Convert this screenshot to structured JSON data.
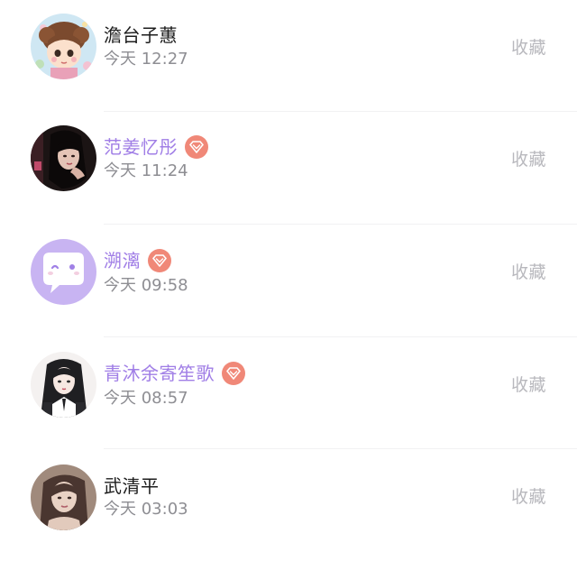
{
  "list": {
    "items": [
      {
        "name": "澹台子蕙",
        "time": "今天 12:27",
        "action": "收藏",
        "vip": false,
        "avatar_icon": "cartoon-girl-avatar"
      },
      {
        "name": "范姜忆彤",
        "time": "今天 11:24",
        "action": "收藏",
        "vip": true,
        "avatar_icon": "photo-girl-dark-avatar"
      },
      {
        "name": "溯漓",
        "time": "今天 09:58",
        "action": "收藏",
        "vip": true,
        "avatar_icon": "chat-bubble-face-avatar"
      },
      {
        "name": "青沐余寄笙歌",
        "time": "今天 08:57",
        "action": "收藏",
        "vip": true,
        "avatar_icon": "anime-girl-sketch-avatar"
      },
      {
        "name": "武清平",
        "time": "今天 03:03",
        "action": "收藏",
        "vip": false,
        "avatar_icon": "photo-woman-avatar"
      }
    ]
  },
  "colors": {
    "vip_name": "#a07ee6",
    "vip_badge": "#f08878",
    "normal_name": "#1c1c1c",
    "time": "#8e8e93",
    "action": "#b8b8bd"
  }
}
